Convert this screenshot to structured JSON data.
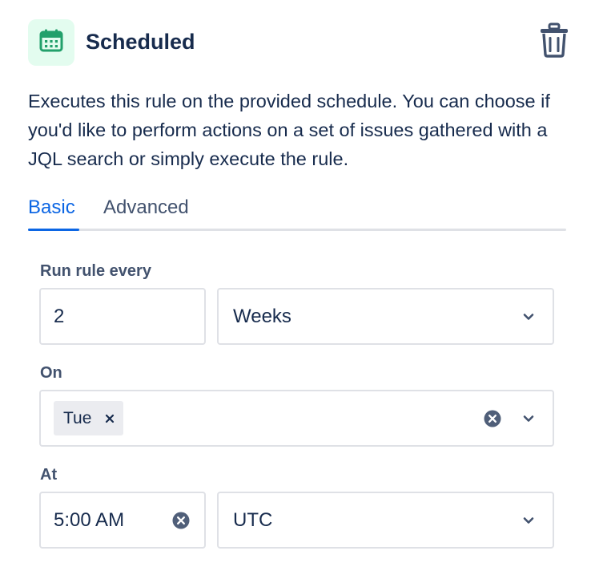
{
  "header": {
    "title": "Scheduled",
    "app_icon": "calendar-icon",
    "delete_icon": "trash-icon"
  },
  "description": "Executes this rule on the provided schedule. You can choose if you'd like to perform actions on a set of issues gathered with a JQL search or simply execute the rule.",
  "tabs": {
    "items": [
      {
        "label": "Basic",
        "active": true
      },
      {
        "label": "Advanced",
        "active": false
      }
    ]
  },
  "run_every": {
    "label": "Run rule every",
    "interval_value": "2",
    "unit_value": "Weeks"
  },
  "on": {
    "label": "On",
    "tags": [
      {
        "label": "Tue"
      }
    ]
  },
  "at": {
    "label": "At",
    "time_value": "5:00 AM",
    "timezone_value": "UTC"
  },
  "colors": {
    "text": "#172B4D",
    "subtle_text": "#42526E",
    "accent": "#0C66E4",
    "icon_green": "#22A06B",
    "icon_bg": "#E3FCEF",
    "border": "#DFE1E6",
    "tag_bg": "#EBECF0"
  }
}
